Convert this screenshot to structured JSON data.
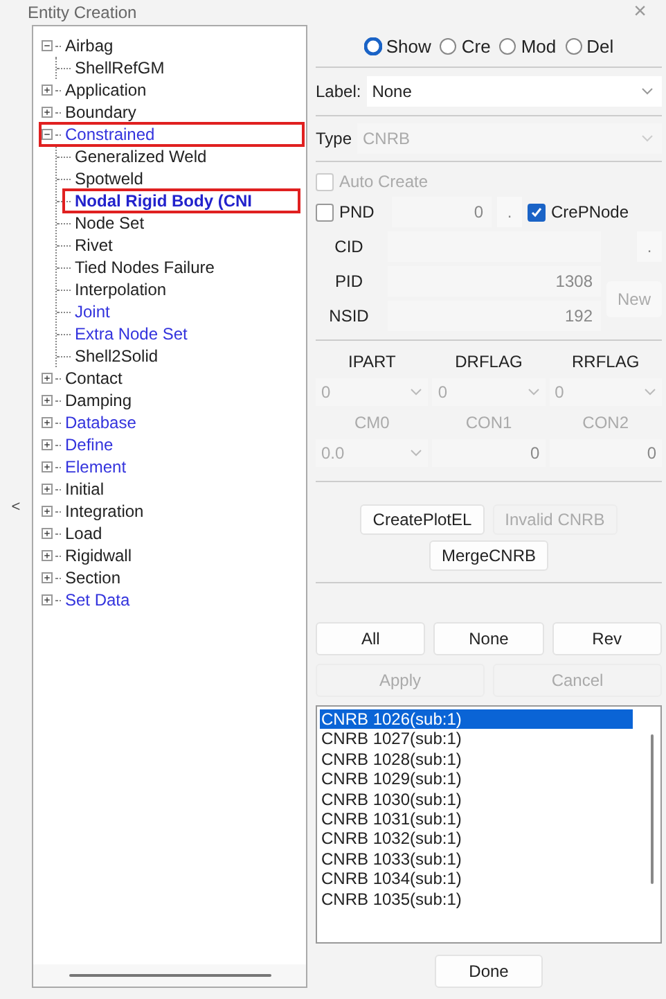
{
  "window": {
    "title": "Entity Creation",
    "close": "×"
  },
  "collapse_handle": "<",
  "tree": [
    {
      "label": "Airbag",
      "expanded": true,
      "linked": false,
      "selected": false,
      "marked": false,
      "children": [
        {
          "label": "ShellRefGM",
          "linked": false,
          "selected": false,
          "marked": false
        }
      ]
    },
    {
      "label": "Application",
      "expanded": false,
      "linked": false,
      "selected": false,
      "marked": false
    },
    {
      "label": "Boundary",
      "expanded": false,
      "linked": false,
      "selected": false,
      "marked": false
    },
    {
      "label": "Constrained",
      "expanded": true,
      "linked": true,
      "selected": false,
      "marked": true,
      "children": [
        {
          "label": "Generalized Weld",
          "linked": false,
          "selected": false,
          "marked": false
        },
        {
          "label": "Spotweld",
          "linked": false,
          "selected": false,
          "marked": false
        },
        {
          "label": "Nodal Rigid Body (CNI",
          "linked": true,
          "selected": true,
          "marked": true
        },
        {
          "label": "Node Set",
          "linked": false,
          "selected": false,
          "marked": false
        },
        {
          "label": "Rivet",
          "linked": false,
          "selected": false,
          "marked": false
        },
        {
          "label": "Tied Nodes Failure",
          "linked": false,
          "selected": false,
          "marked": false
        },
        {
          "label": "Interpolation",
          "linked": false,
          "selected": false,
          "marked": false
        },
        {
          "label": "Joint",
          "linked": true,
          "selected": false,
          "marked": false
        },
        {
          "label": "Extra Node Set",
          "linked": true,
          "selected": false,
          "marked": false
        },
        {
          "label": "Shell2Solid",
          "linked": false,
          "selected": false,
          "marked": false
        }
      ]
    },
    {
      "label": "Contact",
      "expanded": false,
      "linked": false,
      "selected": false,
      "marked": false
    },
    {
      "label": "Damping",
      "expanded": false,
      "linked": false,
      "selected": false,
      "marked": false
    },
    {
      "label": "Database",
      "expanded": false,
      "linked": true,
      "selected": false,
      "marked": false
    },
    {
      "label": "Define",
      "expanded": false,
      "linked": true,
      "selected": false,
      "marked": false
    },
    {
      "label": "Element",
      "expanded": false,
      "linked": true,
      "selected": false,
      "marked": false
    },
    {
      "label": "Initial",
      "expanded": false,
      "linked": false,
      "selected": false,
      "marked": false
    },
    {
      "label": "Integration",
      "expanded": false,
      "linked": false,
      "selected": false,
      "marked": false
    },
    {
      "label": "Load",
      "expanded": false,
      "linked": false,
      "selected": false,
      "marked": false
    },
    {
      "label": "Rigidwall",
      "expanded": false,
      "linked": false,
      "selected": false,
      "marked": false
    },
    {
      "label": "Section",
      "expanded": false,
      "linked": false,
      "selected": false,
      "marked": false
    },
    {
      "label": "Set Data",
      "expanded": false,
      "linked": true,
      "selected": false,
      "marked": false
    }
  ],
  "mode": [
    {
      "label": "Show",
      "selected": true
    },
    {
      "label": "Cre",
      "selected": false
    },
    {
      "label": "Mod",
      "selected": false
    },
    {
      "label": "Del",
      "selected": false
    }
  ],
  "label_field": {
    "label": "Label:",
    "value": "None",
    "disabled": false
  },
  "type_field": {
    "label": "Type",
    "value": "CNRB",
    "disabled": true
  },
  "auto_create": {
    "label": "Auto Create",
    "checked": false,
    "disabled": true
  },
  "pnd": {
    "label": "PND",
    "checked": false,
    "value": "0",
    "pick": "."
  },
  "crep_node": {
    "label": "CrePNode",
    "checked": true
  },
  "cid": {
    "label": "CID",
    "pick": "."
  },
  "pid": {
    "label": "PID",
    "value": "1308"
  },
  "nsid": {
    "label": "NSID",
    "value": "192"
  },
  "new_button": {
    "label": "New",
    "disabled": true
  },
  "flags": [
    {
      "label": "IPART",
      "value": "0",
      "kind": "select",
      "disabled": false
    },
    {
      "label": "DRFLAG",
      "value": "0",
      "kind": "select",
      "disabled": false
    },
    {
      "label": "RRFLAG",
      "value": "0",
      "kind": "select",
      "disabled": false
    }
  ],
  "cons": [
    {
      "label": "CM0",
      "value": "0.0",
      "kind": "select",
      "disabled": true
    },
    {
      "label": "CON1",
      "value": "0",
      "kind": "input",
      "disabled": true
    },
    {
      "label": "CON2",
      "value": "0",
      "kind": "input",
      "disabled": true
    }
  ],
  "actions": [
    {
      "label": "CreatePlotEL",
      "disabled": false
    },
    {
      "label": "Invalid CNRB",
      "disabled": true
    }
  ],
  "merge": {
    "label": "MergeCNRB",
    "disabled": false
  },
  "selection_buttons": [
    {
      "label": "All",
      "disabled": false
    },
    {
      "label": "None",
      "disabled": false
    },
    {
      "label": "Rev",
      "disabled": false
    }
  ],
  "confirm_buttons": [
    {
      "label": "Apply",
      "disabled": true
    },
    {
      "label": "Cancel",
      "disabled": true
    }
  ],
  "list": [
    {
      "label": "CNRB 1026(sub:1)",
      "selected": true
    },
    {
      "label": "CNRB 1027(sub:1)",
      "selected": false
    },
    {
      "label": "CNRB 1028(sub:1)",
      "selected": false
    },
    {
      "label": "CNRB 1029(sub:1)",
      "selected": false
    },
    {
      "label": "CNRB 1030(sub:1)",
      "selected": false
    },
    {
      "label": "CNRB 1031(sub:1)",
      "selected": false
    },
    {
      "label": "CNRB 1032(sub:1)",
      "selected": false
    },
    {
      "label": "CNRB 1033(sub:1)",
      "selected": false
    },
    {
      "label": "CNRB 1034(sub:1)",
      "selected": false
    },
    {
      "label": "CNRB 1035(sub:1)",
      "selected": false
    }
  ],
  "done": {
    "label": "Done"
  }
}
